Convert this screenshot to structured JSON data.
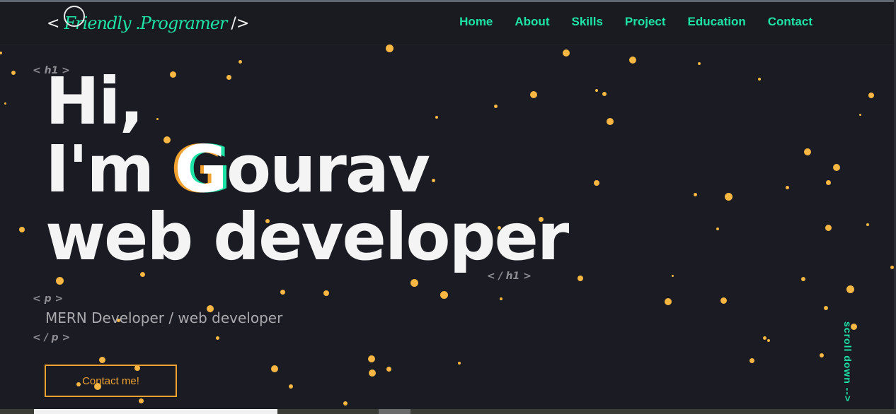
{
  "header": {
    "logo": {
      "open": "<",
      "name": "Friendly .Programer",
      "close": "/>"
    },
    "nav": [
      "Home",
      "About",
      "Skills",
      "Project",
      "Education",
      "Contact"
    ]
  },
  "hero": {
    "tag_open": "< h1 >",
    "greeting": "Hi,",
    "intro_prefix": "I'm ",
    "intro_initial": "G",
    "intro_rest": "ourav",
    "role": "web developer",
    "tag_close": "< / h1 >"
  },
  "about": {
    "tag_open": "< p >",
    "text": "MERN Developer / web developer",
    "tag_close": "< / p >"
  },
  "cta": {
    "label": "Contact me!"
  },
  "scroll": {
    "label": "scroll down -->"
  },
  "colors": {
    "accent_green": "#1ee3a7",
    "accent_orange": "#f0a12f",
    "background": "#1b1b23"
  }
}
